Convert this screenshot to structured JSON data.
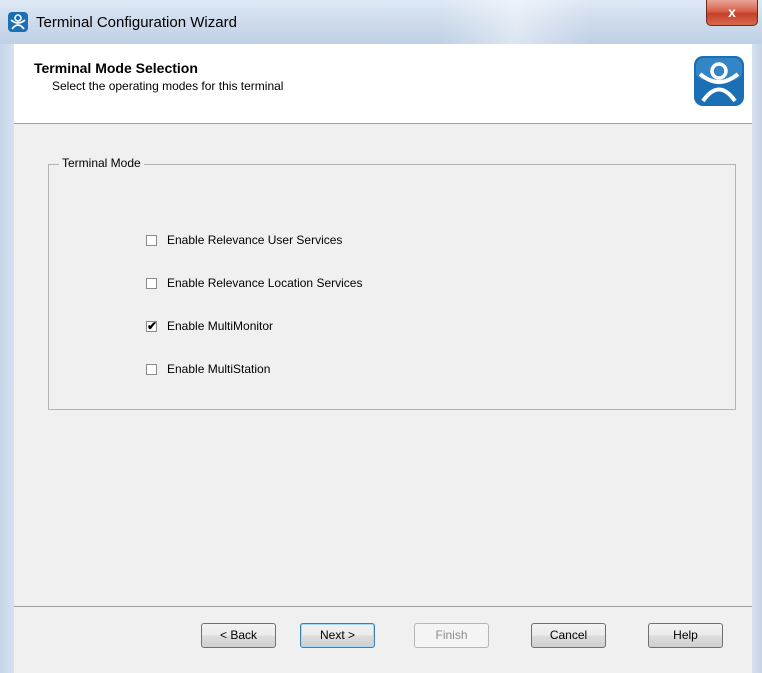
{
  "window": {
    "title": "Terminal Configuration Wizard",
    "close_label": "x"
  },
  "header": {
    "title": "Terminal Mode Selection",
    "subtitle": "Select the operating modes for this terminal",
    "logo_icon": "thintalk-logo-icon"
  },
  "group": {
    "legend": "Terminal Mode",
    "options": [
      {
        "label": "Enable Relevance User Services",
        "checked": false
      },
      {
        "label": "Enable Relevance Location Services",
        "checked": false
      },
      {
        "label": "Enable MultiMonitor",
        "checked": true
      },
      {
        "label": "Enable MultiStation",
        "checked": false
      }
    ]
  },
  "buttons": {
    "back": "< Back",
    "next": "Next >",
    "finish": "Finish",
    "cancel": "Cancel",
    "help": "Help"
  },
  "colors": {
    "close_button": "#c7402a",
    "header_bg": "#ffffff",
    "content_bg": "#f0f0f0",
    "logo_blue": "#1a6fb5"
  }
}
